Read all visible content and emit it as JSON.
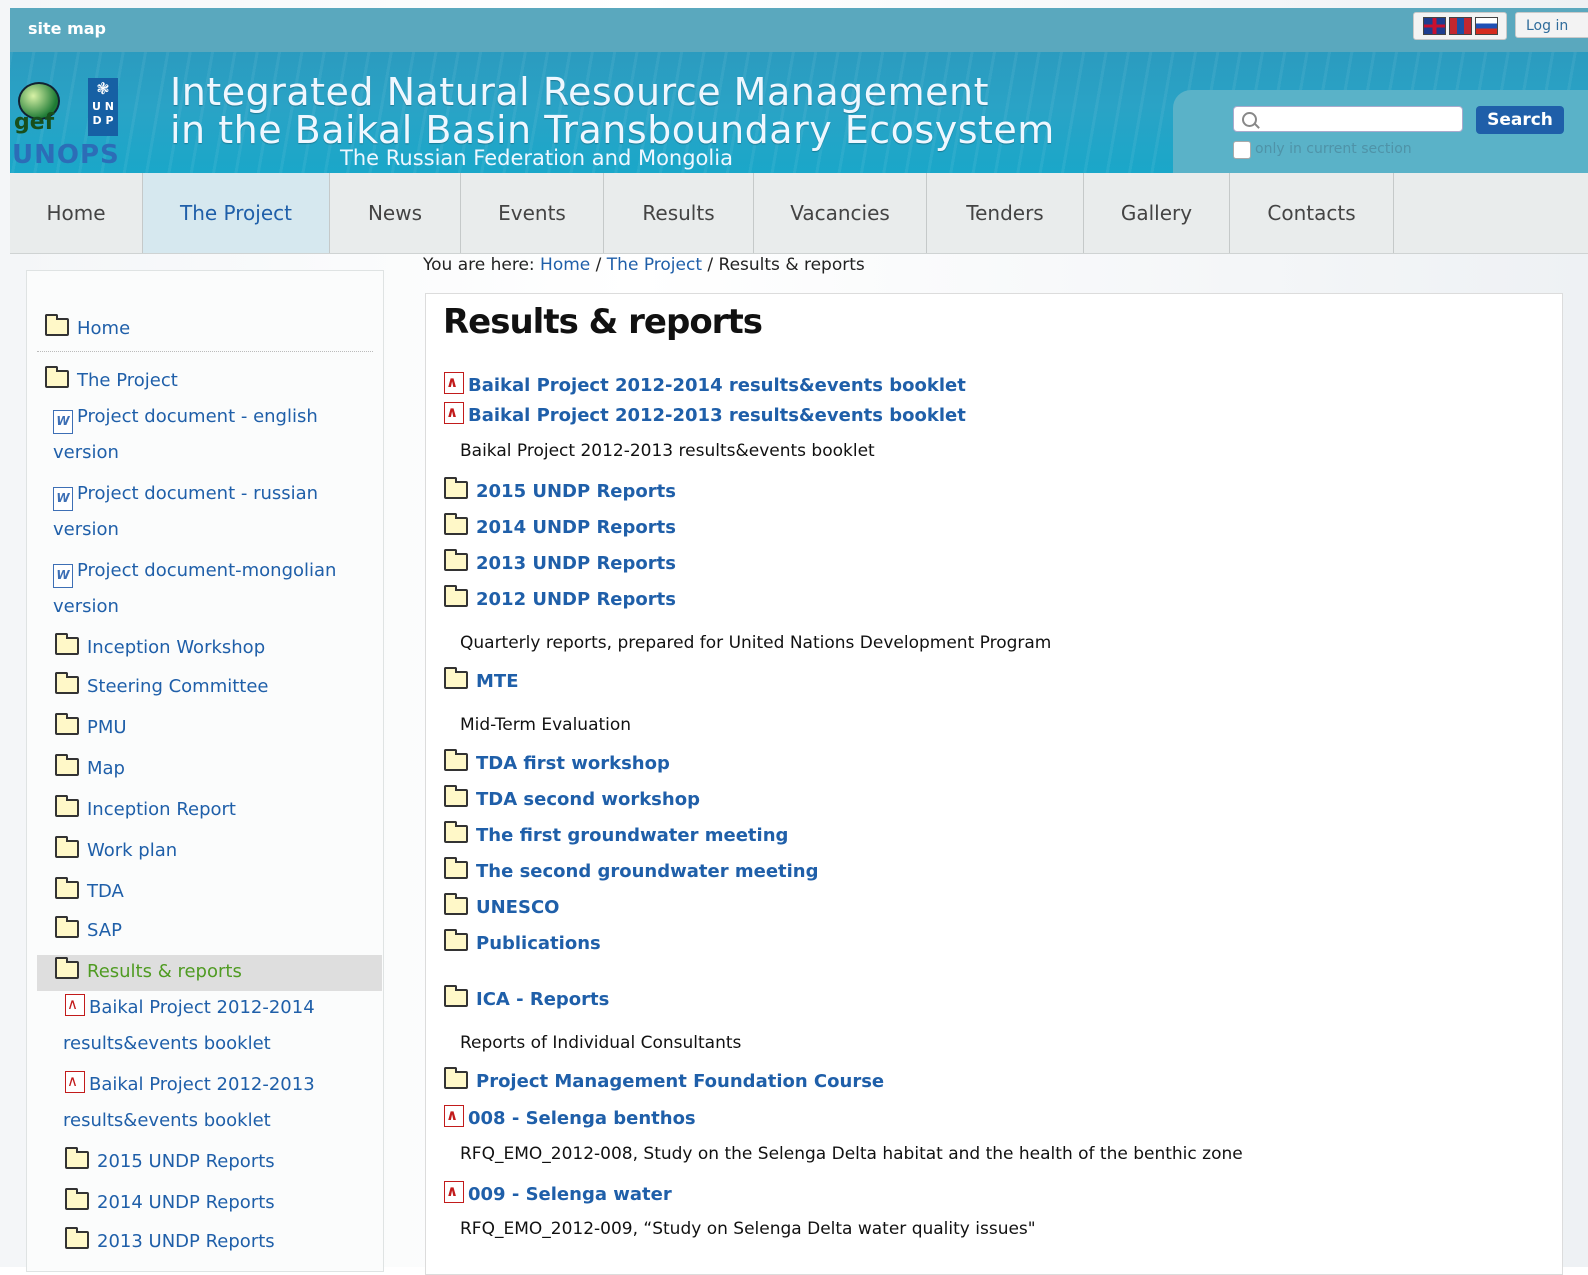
{
  "topbar": {
    "sitemap": "site map",
    "login": "Log in"
  },
  "banner": {
    "gef": "gef",
    "undp": [
      "U N",
      "D P"
    ],
    "unops": "UNOPS",
    "title_line1": "Integrated Natural Resource Management",
    "title_line2": "in the Baikal Basin Transboundary Ecosystem",
    "subtitle": "The Russian Federation and Mongolia"
  },
  "search": {
    "placeholder": "",
    "button": "Search",
    "only_label": "only in current section"
  },
  "nav": [
    {
      "label": "Home"
    },
    {
      "label": "The Project",
      "active": true
    },
    {
      "label": "News"
    },
    {
      "label": "Events"
    },
    {
      "label": "Results"
    },
    {
      "label": "Vacancies"
    },
    {
      "label": "Tenders"
    },
    {
      "label": "Gallery"
    },
    {
      "label": "Contacts"
    }
  ],
  "breadcrumb": {
    "prefix": "You are here:",
    "home": "Home",
    "project": "The Project",
    "current": "Results & reports"
  },
  "sidebar": {
    "home": "Home",
    "project": "The Project",
    "doc_en": [
      "Project document - english",
      "version"
    ],
    "doc_ru": [
      "Project document - russian",
      "version"
    ],
    "doc_mn": [
      "Project document-mongolian",
      "version"
    ],
    "items": [
      "Inception Workshop",
      "Steering Committee",
      "PMU",
      "Map",
      "Inception Report",
      "Work plan",
      "TDA",
      "SAP"
    ],
    "current": "Results & reports",
    "booklet_2014": [
      "Baikal Project 2012-2014",
      "results&events booklet"
    ],
    "booklet_2013": [
      "Baikal Project 2012-2013",
      "results&events booklet"
    ],
    "reports": [
      "2015 UNDP Reports",
      "2014 UNDP Reports",
      "2013 UNDP Reports"
    ]
  },
  "main": {
    "title": "Results & reports",
    "booklet_2014": "Baikal Project 2012-2014 results&events booklet",
    "booklet_2013": "Baikal Project 2012-2013 results&events booklet",
    "booklet_2013_desc": "Baikal Project 2012-2013 results&events booklet",
    "undp": [
      "2015 UNDP Reports",
      "2014 UNDP Reports",
      "2013 UNDP Reports",
      "2012 UNDP Reports"
    ],
    "undp_desc": "Quarterly reports, prepared for United Nations Development Program",
    "mte": "MTE",
    "mte_desc": "Mid-Term Evaluation",
    "folders": [
      "TDA first workshop",
      "TDA second workshop",
      "The first groundwater meeting",
      "The second groundwater meeting",
      "UNESCO",
      "Publications"
    ],
    "ica": "ICA - Reports",
    "ica_desc": "Reports of Individual Consultants",
    "pmfc": "Project Management Foundation Course",
    "f008": "008 - Selenga benthos",
    "f008_desc": "RFQ_EMO_2012-008, Study on the Selenga Delta habitat and the health of the benthic zone",
    "f009": "009 - Selenga water",
    "f009_desc": "RFQ_EMO_2012-009, “Study on Selenga Delta water quality issues\""
  }
}
